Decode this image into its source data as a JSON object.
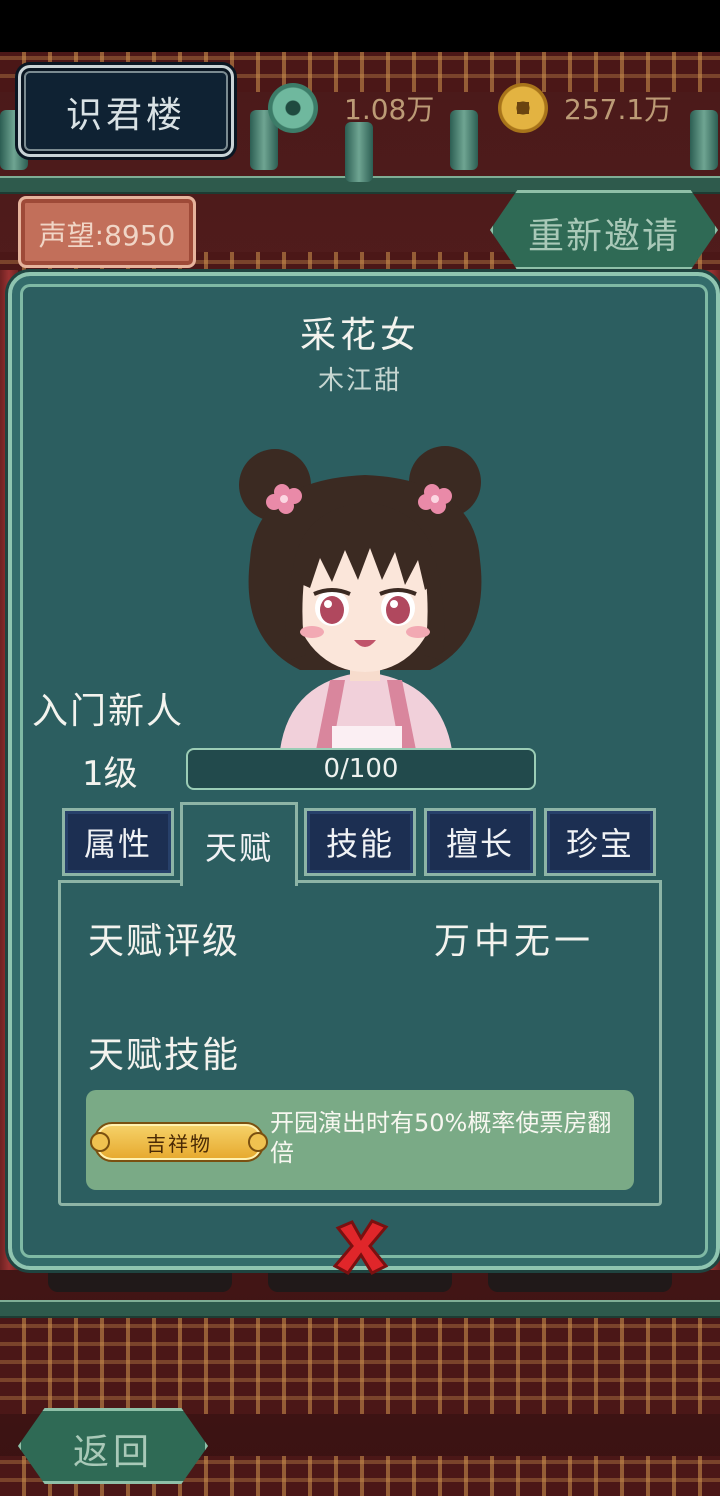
{
  "header": {
    "title": "识君楼",
    "jade_currency": "1.08万",
    "gold_currency": "257.1万",
    "reputation": "声望:8950",
    "reinvite_label": "重新邀请"
  },
  "character": {
    "name": "采花女",
    "subname": "木江甜",
    "rank": "入门新人",
    "level": "1级",
    "exp_text": "0/100",
    "exp_fraction": 0.0
  },
  "tabs": [
    {
      "label": "属性",
      "active": false
    },
    {
      "label": "天赋",
      "active": true
    },
    {
      "label": "技能",
      "active": false
    },
    {
      "label": "擅长",
      "active": false
    },
    {
      "label": "珍宝",
      "active": false
    }
  ],
  "talent": {
    "rating_label": "天赋评级",
    "rating_value": "万中无一",
    "skill_label": "天赋技能",
    "skill_badge": "吉祥物",
    "skill_desc": "开园演出时有50%概率使票房翻倍"
  },
  "footer": {
    "back_label": "返回"
  },
  "colors": {
    "panel": "#2c5e60",
    "panel_border": "#8fc5b0",
    "tab_bg": "#1c2f52",
    "skill_box": "#7aaa86",
    "close_x": "#e0262a"
  },
  "icons": [
    "jade-coin-icon",
    "gold-coin-icon",
    "close-icon"
  ]
}
